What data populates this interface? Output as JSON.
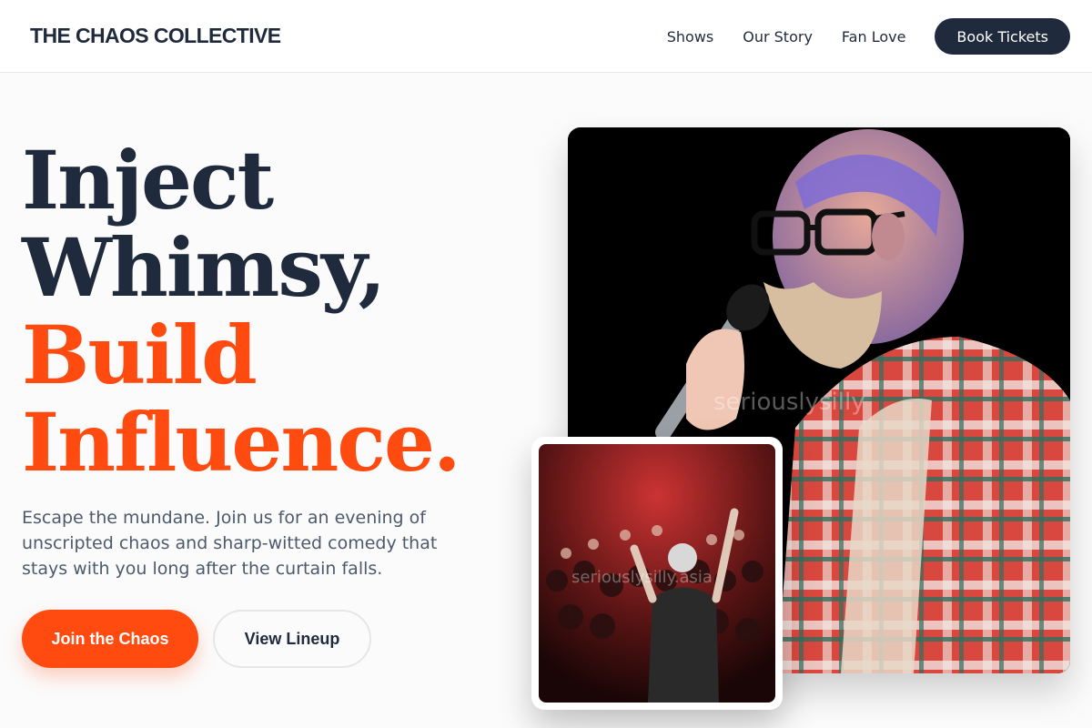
{
  "brand": "THE CHAOS COLLECTIVE",
  "nav": {
    "links": [
      "Shows",
      "Our Story",
      "Fan Love"
    ],
    "cta": "Book Tickets"
  },
  "hero": {
    "headline_dark": [
      "Inject",
      "Whimsy,"
    ],
    "headline_accent": [
      "Build",
      "Influence."
    ],
    "lead": "Escape the mundane. Join us for an evening of unscripted chaos and sharp-witted comedy that stays with you long after the curtain falls.",
    "primary_cta": "Join the Chaos",
    "secondary_cta": "View Lineup"
  },
  "images": {
    "main_watermark": "seriouslysilly",
    "crowd_watermark": "seriouslysilly.asia"
  },
  "colors": {
    "navy": "#1f2a3c",
    "accent": "#ff4a10",
    "background": "#fbfbfb"
  }
}
